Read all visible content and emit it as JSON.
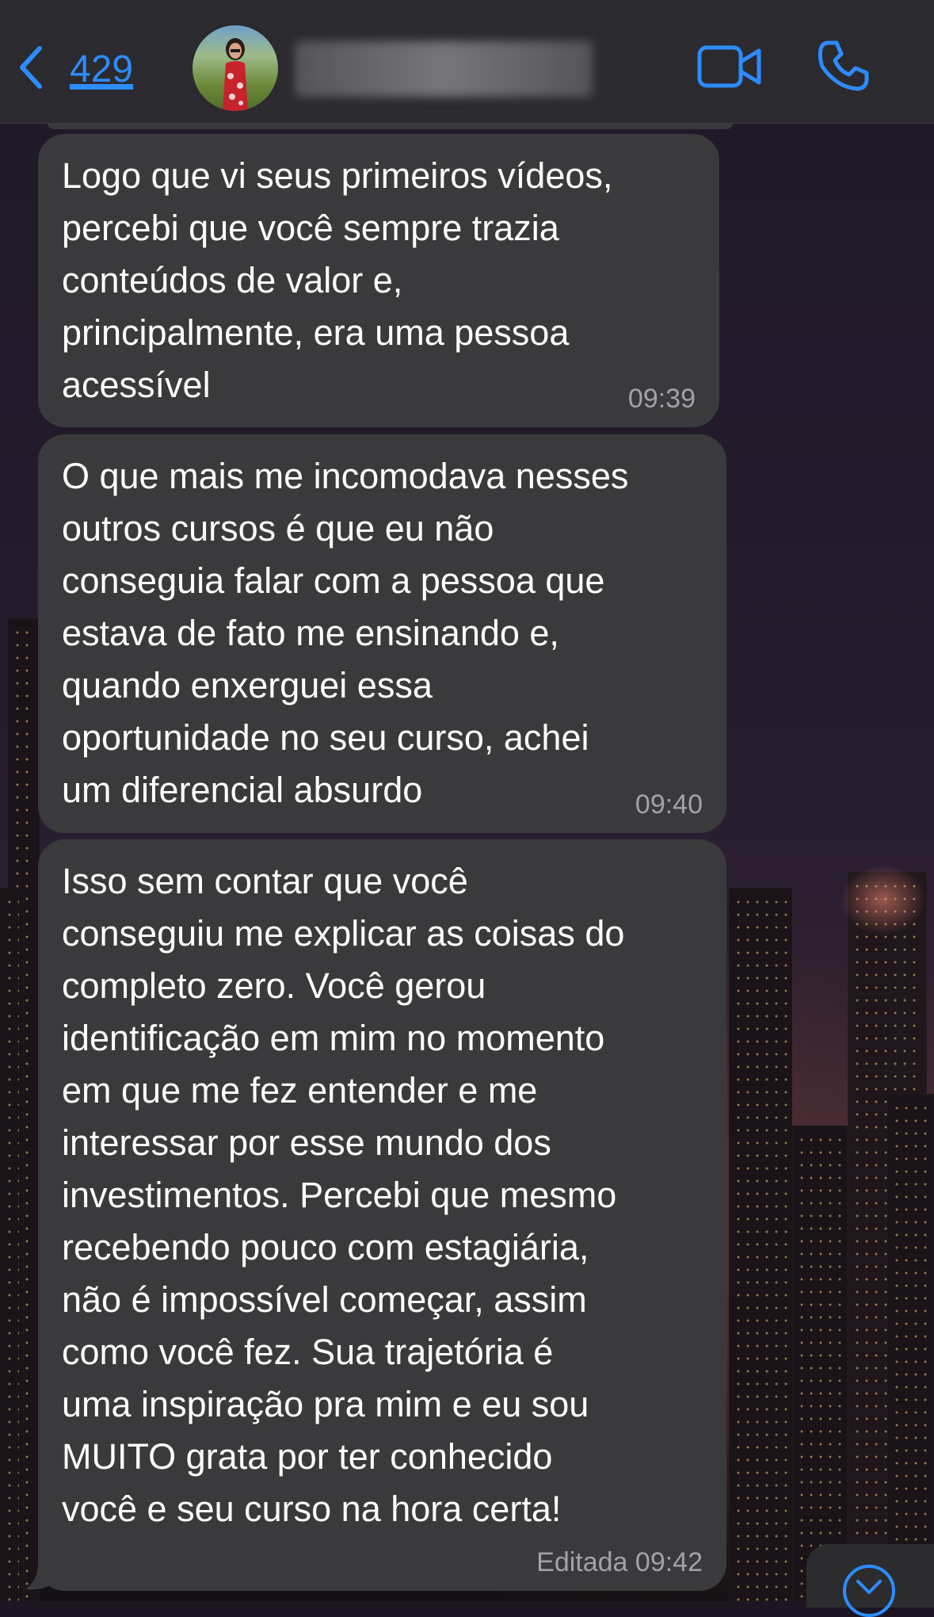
{
  "header": {
    "back_count": "429",
    "contact_name": ""
  },
  "messages": [
    {
      "text": "Logo que vi seus primeiros vídeos,\npercebi que você sempre trazia\nconteúdos de valor e,\nprincipalmente, era uma pessoa\nacessível",
      "time": "09:39"
    },
    {
      "text": "O que mais me incomodava nesses\noutros cursos é que eu não\nconseguia falar com a pessoa que\nestava de fato me ensinando e,\nquando enxerguei essa\noportunidade no seu curso, achei\num diferencial absurdo",
      "time": "09:40"
    },
    {
      "text": "Isso sem contar que você\nconseguiu me explicar as coisas do\ncompleto zero. Você gerou\nidentificação em mim no momento\nem que me fez entender e me\ninteressar por esse mundo dos\ninvestimentos. Percebi que mesmo\nrecebendo pouco com estagiária,\nnão é impossível começar, assim\ncomo você fez. Sua trajetória é\numa inspiração pra mim e eu sou\nMUITO grata por ter conhecido\nvocê e seu curso na hora certa!",
      "time": "Editada 09:42"
    }
  ],
  "colors": {
    "accent": "#2d8cff",
    "bubble": "#3a3a3c",
    "header": "#2c2c30",
    "timestamp": "#a2a2a7"
  },
  "icons": {
    "back": "chevron-left-icon",
    "video": "video-camera-icon",
    "phone": "phone-icon",
    "scroll": "chevron-down-icon"
  }
}
